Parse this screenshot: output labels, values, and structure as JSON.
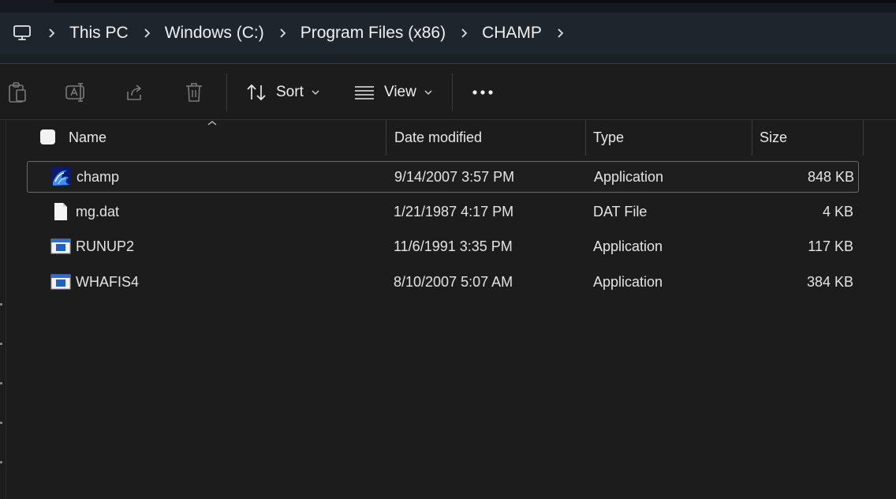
{
  "breadcrumb": {
    "items": [
      "This PC",
      "Windows (C:)",
      "Program Files (x86)",
      "CHAMP"
    ],
    "root_icon": "monitor-icon",
    "separator_icon": "chevron-right-icon"
  },
  "toolbar": {
    "icons": [
      "paste-icon",
      "rename-icon",
      "share-icon",
      "delete-icon"
    ],
    "sort_label": "Sort",
    "view_label": "View",
    "more_icon": "more-dots-icon"
  },
  "columns": {
    "name": "Name",
    "date": "Date modified",
    "type": "Type",
    "size": "Size"
  },
  "files": [
    {
      "name": "champ",
      "date": "9/14/2007 3:57 PM",
      "type": "Application",
      "size": "848 KB",
      "icon": "wave-app-icon",
      "selected": true
    },
    {
      "name": "mg.dat",
      "date": "1/21/1987 4:17 PM",
      "type": "DAT File",
      "size": "4 KB",
      "icon": "document-icon",
      "selected": false
    },
    {
      "name": "RUNUP2",
      "date": "11/6/1991 3:35 PM",
      "type": "Application",
      "size": "117 KB",
      "icon": "window-app-icon",
      "selected": false
    },
    {
      "name": "WHAFIS4",
      "date": "8/10/2007 5:07 AM",
      "type": "Application",
      "size": "384 KB",
      "icon": "window-app-icon",
      "selected": false
    }
  ],
  "colors": {
    "background": "#1c1c1c",
    "address_bar": "#1f252d",
    "text": "#e6e6e6"
  }
}
